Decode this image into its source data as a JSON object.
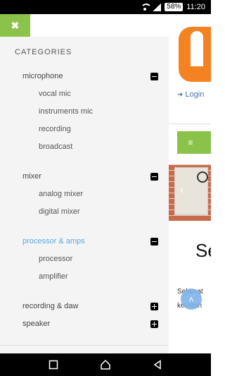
{
  "status_bar": {
    "battery": "58%",
    "time": "11:20"
  },
  "drawer": {
    "close_glyph": "✖",
    "heading": "CATEGORIES",
    "categories": [
      {
        "label": "microphone",
        "expanded": true,
        "active": false,
        "children": [
          "vocal mic",
          "instruments mic",
          "recording",
          "broadcast"
        ]
      },
      {
        "label": "mixer",
        "expanded": true,
        "active": false,
        "children": [
          "analog mixer",
          "digital mixer"
        ]
      },
      {
        "label": "processor & amps",
        "expanded": true,
        "active": true,
        "children": [
          "processor",
          "amplifier"
        ]
      },
      {
        "label": "recording & daw",
        "expanded": false,
        "active": false,
        "children": []
      },
      {
        "label": "speaker",
        "expanded": false,
        "active": false,
        "children": []
      }
    ]
  },
  "page": {
    "login_label": "Login",
    "menu_glyph": "≡",
    "section_heading": "Se",
    "body_line_1": "Selamat",
    "body_line_2": "keindah",
    "scroll_top_glyph": "˄"
  },
  "colors": {
    "accent_green": "#8bc34a",
    "active_blue": "#5aa8e0",
    "logo_orange": "#f58220"
  }
}
